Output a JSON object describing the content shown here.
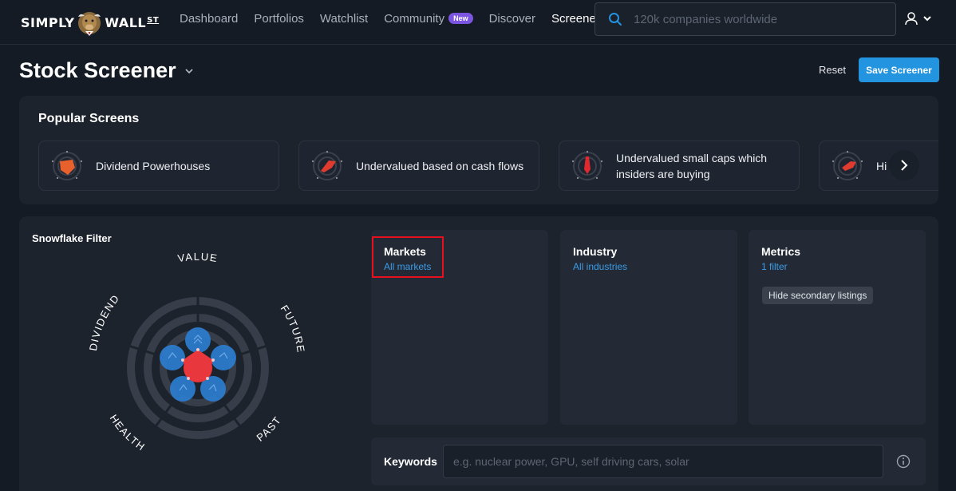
{
  "brand": {
    "name_left": "SIMPLY",
    "name_right": "WALL",
    "name_suffix": "ST"
  },
  "nav": {
    "links": [
      {
        "label": "Dashboard"
      },
      {
        "label": "Portfolios"
      },
      {
        "label": "Watchlist"
      },
      {
        "label": "Community",
        "badge": "New"
      },
      {
        "label": "Discover"
      },
      {
        "label": "Screener",
        "active": true
      }
    ]
  },
  "search": {
    "placeholder": "120k companies worldwide",
    "icon": "search-icon"
  },
  "user_menu": {
    "icon": "user-icon"
  },
  "header": {
    "title": "Stock Screener",
    "reset_label": "Reset",
    "save_label": "Save Screener"
  },
  "popular": {
    "title": "Popular Screens",
    "cards": [
      {
        "label": "Dividend Powerhouses",
        "color": "#e8612c"
      },
      {
        "label": "Undervalued based on cash flows",
        "color": "#e03b2f"
      },
      {
        "label": "Undervalued small caps which insiders are buying",
        "color": "#e0292f"
      },
      {
        "label": "Hi",
        "color": "#e03b2f"
      }
    ]
  },
  "snowflake": {
    "title": "Snowflake Filter",
    "axes": [
      "VALUE",
      "FUTURE",
      "PAST",
      "HEALTH",
      "DIVIDEND"
    ],
    "center_color": "#e8383d",
    "petal_color": "#2d7fd3"
  },
  "filters": {
    "markets": {
      "title": "Markets",
      "value": "All markets"
    },
    "industry": {
      "title": "Industry",
      "value": "All industries"
    },
    "metrics": {
      "title": "Metrics",
      "value": "1 filter",
      "chip": "Hide secondary listings"
    }
  },
  "keywords": {
    "label": "Keywords",
    "placeholder": "e.g. nuclear power, GPU, self driving cars, solar"
  },
  "colors": {
    "background": "#151b24",
    "panel": "#1d232d",
    "accent": "#2394df",
    "highlight": "#e8101f"
  }
}
